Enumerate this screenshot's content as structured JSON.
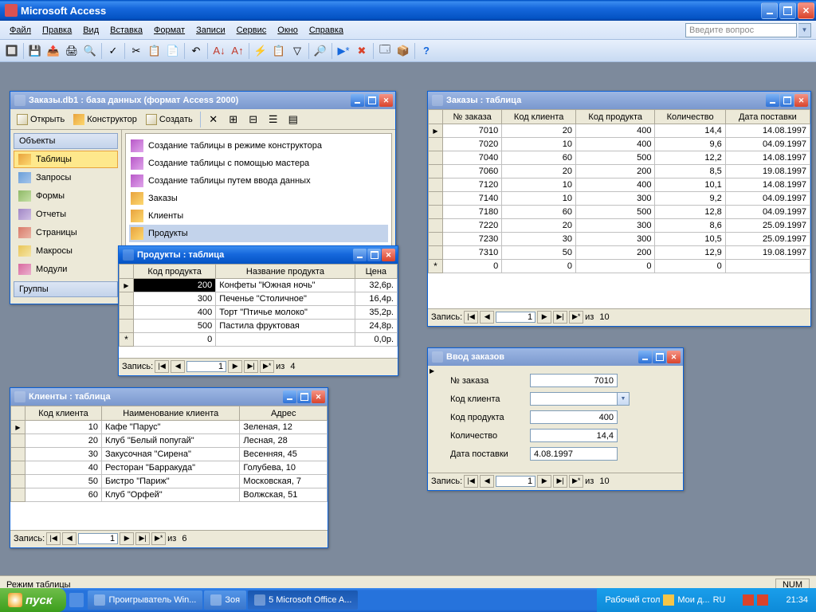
{
  "app": {
    "title": "Microsoft Access"
  },
  "menu": {
    "items": [
      "Файл",
      "Правка",
      "Вид",
      "Вставка",
      "Формат",
      "Записи",
      "Сервис",
      "Окно",
      "Справка"
    ],
    "ask": "Введите вопрос"
  },
  "status": {
    "mode": "Режим таблицы",
    "numlock": "NUM"
  },
  "db_window": {
    "title": "Заказы.db1 : база данных (формат Access 2000)",
    "toolbar": {
      "open": "Открыть",
      "design": "Конструктор",
      "create": "Создать"
    },
    "nav_header": "Объекты",
    "nav": [
      "Таблицы",
      "Запросы",
      "Формы",
      "Отчеты",
      "Страницы",
      "Макросы",
      "Модули"
    ],
    "groups": "Группы",
    "wizards": [
      "Создание таблицы в режиме конструктора",
      "Создание таблицы с помощью мастера",
      "Создание таблицы путем ввода данных"
    ],
    "tables": [
      "Заказы",
      "Клиенты",
      "Продукты"
    ]
  },
  "orders_table": {
    "title": "Заказы : таблица",
    "columns": [
      "№ заказа",
      "Код клиента",
      "Код продукта",
      "Количество",
      "Дата поставки"
    ],
    "rows": [
      [
        7010,
        20,
        400,
        "14,4",
        "14.08.1997"
      ],
      [
        7020,
        10,
        400,
        "9,6",
        "04.09.1997"
      ],
      [
        7040,
        60,
        500,
        "12,2",
        "14.08.1997"
      ],
      [
        7060,
        20,
        200,
        "8,5",
        "19.08.1997"
      ],
      [
        7120,
        10,
        400,
        "10,1",
        "14.08.1997"
      ],
      [
        7140,
        10,
        300,
        "9,2",
        "04.09.1997"
      ],
      [
        7180,
        60,
        500,
        "12,8",
        "04.09.1997"
      ],
      [
        7220,
        20,
        300,
        "8,6",
        "25.09.1997"
      ],
      [
        7230,
        30,
        300,
        "10,5",
        "25.09.1997"
      ],
      [
        7310,
        50,
        200,
        "12,9",
        "19.08.1997"
      ]
    ],
    "newrow": [
      0,
      0,
      0,
      0,
      ""
    ],
    "rec_label": "Запись:",
    "rec_num": "1",
    "rec_of_label": "из",
    "rec_total": "10"
  },
  "products_table": {
    "title": "Продукты : таблица",
    "columns": [
      "Код продукта",
      "Название продукта",
      "Цена"
    ],
    "rows": [
      [
        "200",
        "Конфеты \"Южная ночь\"",
        "32,6р."
      ],
      [
        "300",
        "Печенье \"Столичное\"",
        "16,4р."
      ],
      [
        "400",
        "Торт \"Птичье молоко\"",
        "35,2р."
      ],
      [
        "500",
        "Пастила фруктовая",
        "24,8р."
      ]
    ],
    "newrow": [
      "0",
      "",
      "0,0р."
    ],
    "rec_label": "Запись:",
    "rec_num": "1",
    "rec_of_label": "из",
    "rec_total": "4"
  },
  "clients_table": {
    "title": "Клиенты : таблица",
    "columns": [
      "Код клиента",
      "Наименование клиента",
      "Адрес"
    ],
    "rows": [
      [
        "10",
        "Кафе \"Парус\"",
        "Зеленая, 12"
      ],
      [
        "20",
        "Клуб \"Белый попугай\"",
        "Лесная, 28"
      ],
      [
        "30",
        "Закусочная \"Сирена\"",
        "Весенняя, 45"
      ],
      [
        "40",
        "Ресторан \"Барракуда\"",
        "Голубева, 10"
      ],
      [
        "50",
        "Бистро \"Париж\"",
        "Московская, 7"
      ],
      [
        "60",
        "Клуб \"Орфей\"",
        "Волжская, 51"
      ]
    ],
    "rec_label": "Запись:",
    "rec_num": "1",
    "rec_of_label": "из",
    "rec_total": "6"
  },
  "form": {
    "title": "Ввод заказов",
    "fields": {
      "order_no": {
        "label": "№ заказа",
        "value": "7010"
      },
      "client": {
        "label": "Код клиента",
        "value": ""
      },
      "product": {
        "label": "Код продукта",
        "value": "400"
      },
      "qty": {
        "label": "Количество",
        "value": "14,4"
      },
      "date": {
        "label": "Дата поставки",
        "value": "4.08.1997"
      }
    },
    "rec_label": "Запись:",
    "rec_num": "1",
    "rec_of_label": "из",
    "rec_total": "10"
  },
  "taskbar": {
    "start": "пуск",
    "items": [
      "Проигрыватель Win...",
      "Зоя",
      "5 Microsoft Office A..."
    ],
    "desktop": "Рабочий стол",
    "mydocs": "Мои д...",
    "lang": "RU",
    "time": "21:34"
  }
}
